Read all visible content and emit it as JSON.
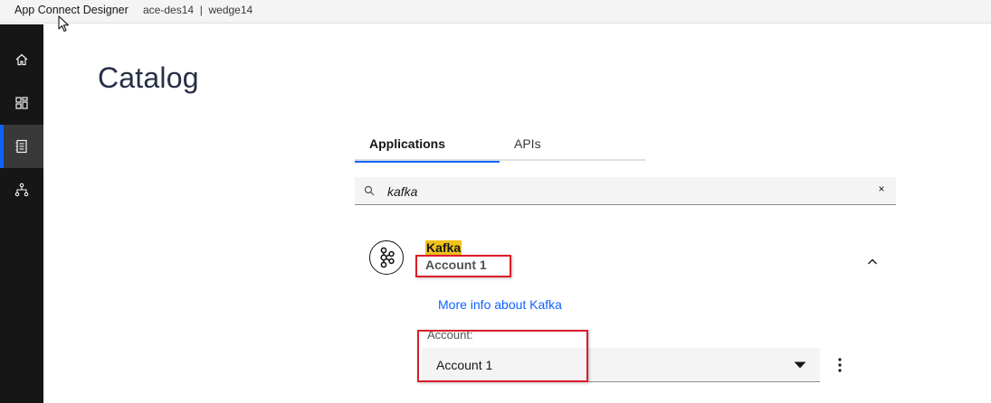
{
  "header": {
    "app_title": "App Connect Designer",
    "instance": "ace-des14  |  wedge14"
  },
  "sidebar": {
    "items": [
      {
        "icon": "home-icon"
      },
      {
        "icon": "dashboard-icon"
      },
      {
        "icon": "catalog-icon",
        "active": true
      },
      {
        "icon": "hierarchy-icon"
      }
    ]
  },
  "page": {
    "title": "Catalog"
  },
  "tabs": [
    {
      "label": "Applications",
      "selected": true
    },
    {
      "label": "APIs",
      "selected": false
    }
  ],
  "search": {
    "value": "kafka",
    "placeholder": "",
    "clear_glyph": "×"
  },
  "app": {
    "name": "Kafka",
    "account_name": "Account 1",
    "more_info_link": "More info about Kafka",
    "account_label": "Account:",
    "selected_account": "Account 1"
  },
  "colors": {
    "accent": "#0f62fe",
    "highlight": "#f1c21b",
    "annotation": "#da1e28",
    "sidebar": "#161616"
  }
}
